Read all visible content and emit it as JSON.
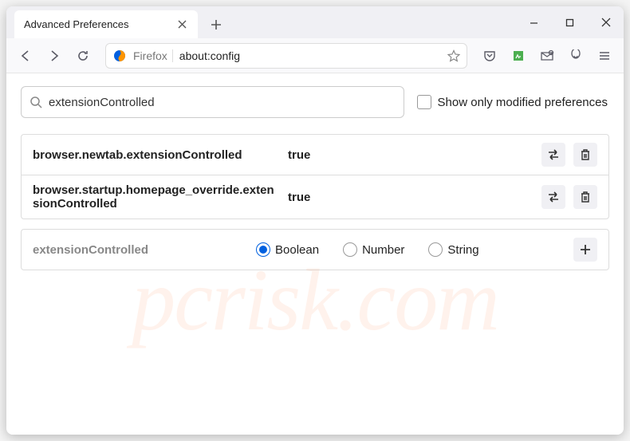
{
  "window": {
    "tab_title": "Advanced Preferences"
  },
  "toolbar": {
    "firefox_label": "Firefox",
    "url": "about:config"
  },
  "search": {
    "value": "extensionControlled",
    "modified_only_label": "Show only modified preferences"
  },
  "prefs": [
    {
      "name": "browser.newtab.extensionControlled",
      "value": "true"
    },
    {
      "name": "browser.startup.homepage_override.extensionControlled",
      "value": "true"
    }
  ],
  "new_pref": {
    "name": "extensionControlled",
    "types": [
      "Boolean",
      "Number",
      "String"
    ],
    "selected": 0
  },
  "watermark": "pcrisk.com"
}
